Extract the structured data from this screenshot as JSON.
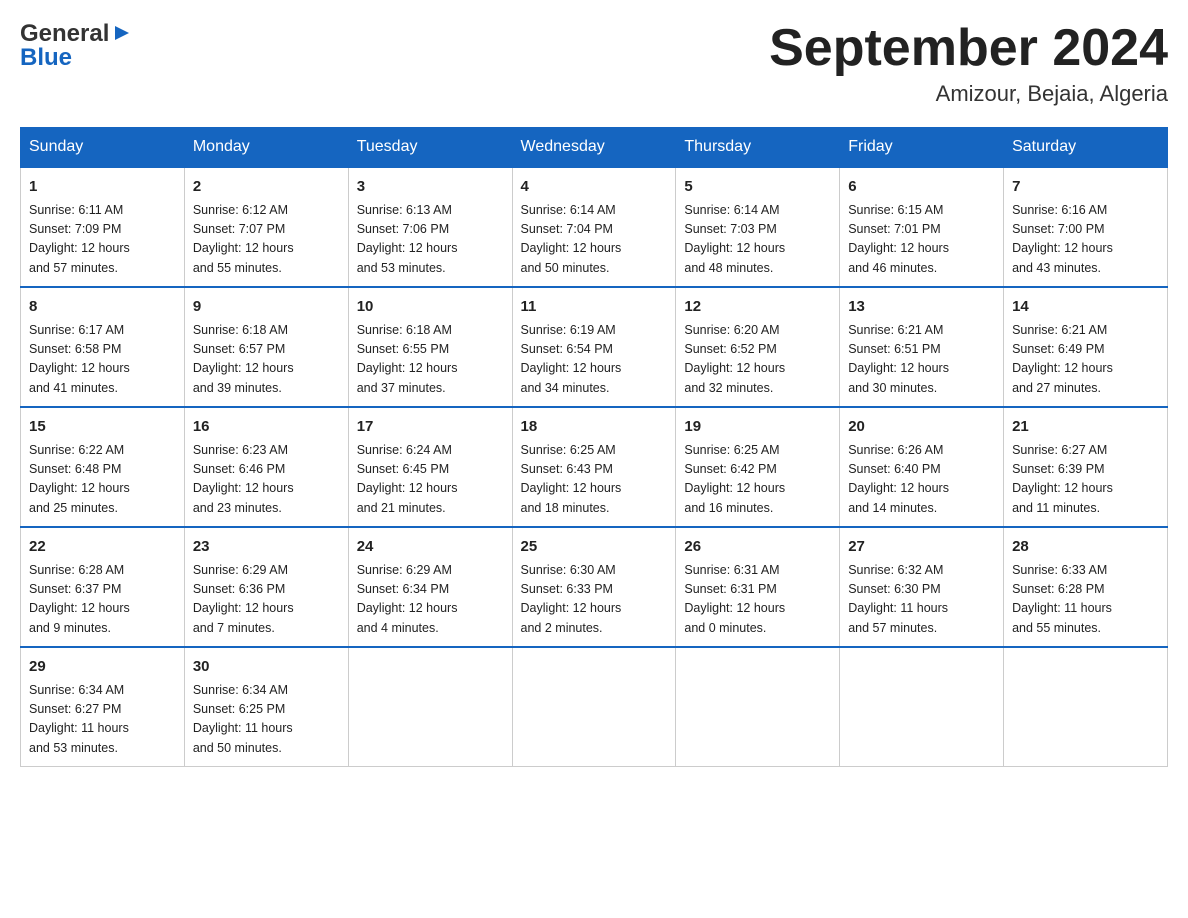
{
  "header": {
    "logo_general": "General",
    "logo_blue": "Blue",
    "month": "September 2024",
    "location": "Amizour, Bejaia, Algeria"
  },
  "days_of_week": [
    "Sunday",
    "Monday",
    "Tuesday",
    "Wednesday",
    "Thursday",
    "Friday",
    "Saturday"
  ],
  "weeks": [
    [
      {
        "day": "1",
        "sunrise": "6:11 AM",
        "sunset": "7:09 PM",
        "daylight": "12 hours and 57 minutes."
      },
      {
        "day": "2",
        "sunrise": "6:12 AM",
        "sunset": "7:07 PM",
        "daylight": "12 hours and 55 minutes."
      },
      {
        "day": "3",
        "sunrise": "6:13 AM",
        "sunset": "7:06 PM",
        "daylight": "12 hours and 53 minutes."
      },
      {
        "day": "4",
        "sunrise": "6:14 AM",
        "sunset": "7:04 PM",
        "daylight": "12 hours and 50 minutes."
      },
      {
        "day": "5",
        "sunrise": "6:14 AM",
        "sunset": "7:03 PM",
        "daylight": "12 hours and 48 minutes."
      },
      {
        "day": "6",
        "sunrise": "6:15 AM",
        "sunset": "7:01 PM",
        "daylight": "12 hours and 46 minutes."
      },
      {
        "day": "7",
        "sunrise": "6:16 AM",
        "sunset": "7:00 PM",
        "daylight": "12 hours and 43 minutes."
      }
    ],
    [
      {
        "day": "8",
        "sunrise": "6:17 AM",
        "sunset": "6:58 PM",
        "daylight": "12 hours and 41 minutes."
      },
      {
        "day": "9",
        "sunrise": "6:18 AM",
        "sunset": "6:57 PM",
        "daylight": "12 hours and 39 minutes."
      },
      {
        "day": "10",
        "sunrise": "6:18 AM",
        "sunset": "6:55 PM",
        "daylight": "12 hours and 37 minutes."
      },
      {
        "day": "11",
        "sunrise": "6:19 AM",
        "sunset": "6:54 PM",
        "daylight": "12 hours and 34 minutes."
      },
      {
        "day": "12",
        "sunrise": "6:20 AM",
        "sunset": "6:52 PM",
        "daylight": "12 hours and 32 minutes."
      },
      {
        "day": "13",
        "sunrise": "6:21 AM",
        "sunset": "6:51 PM",
        "daylight": "12 hours and 30 minutes."
      },
      {
        "day": "14",
        "sunrise": "6:21 AM",
        "sunset": "6:49 PM",
        "daylight": "12 hours and 27 minutes."
      }
    ],
    [
      {
        "day": "15",
        "sunrise": "6:22 AM",
        "sunset": "6:48 PM",
        "daylight": "12 hours and 25 minutes."
      },
      {
        "day": "16",
        "sunrise": "6:23 AM",
        "sunset": "6:46 PM",
        "daylight": "12 hours and 23 minutes."
      },
      {
        "day": "17",
        "sunrise": "6:24 AM",
        "sunset": "6:45 PM",
        "daylight": "12 hours and 21 minutes."
      },
      {
        "day": "18",
        "sunrise": "6:25 AM",
        "sunset": "6:43 PM",
        "daylight": "12 hours and 18 minutes."
      },
      {
        "day": "19",
        "sunrise": "6:25 AM",
        "sunset": "6:42 PM",
        "daylight": "12 hours and 16 minutes."
      },
      {
        "day": "20",
        "sunrise": "6:26 AM",
        "sunset": "6:40 PM",
        "daylight": "12 hours and 14 minutes."
      },
      {
        "day": "21",
        "sunrise": "6:27 AM",
        "sunset": "6:39 PM",
        "daylight": "12 hours and 11 minutes."
      }
    ],
    [
      {
        "day": "22",
        "sunrise": "6:28 AM",
        "sunset": "6:37 PM",
        "daylight": "12 hours and 9 minutes."
      },
      {
        "day": "23",
        "sunrise": "6:29 AM",
        "sunset": "6:36 PM",
        "daylight": "12 hours and 7 minutes."
      },
      {
        "day": "24",
        "sunrise": "6:29 AM",
        "sunset": "6:34 PM",
        "daylight": "12 hours and 4 minutes."
      },
      {
        "day": "25",
        "sunrise": "6:30 AM",
        "sunset": "6:33 PM",
        "daylight": "12 hours and 2 minutes."
      },
      {
        "day": "26",
        "sunrise": "6:31 AM",
        "sunset": "6:31 PM",
        "daylight": "12 hours and 0 minutes."
      },
      {
        "day": "27",
        "sunrise": "6:32 AM",
        "sunset": "6:30 PM",
        "daylight": "11 hours and 57 minutes."
      },
      {
        "day": "28",
        "sunrise": "6:33 AM",
        "sunset": "6:28 PM",
        "daylight": "11 hours and 55 minutes."
      }
    ],
    [
      {
        "day": "29",
        "sunrise": "6:34 AM",
        "sunset": "6:27 PM",
        "daylight": "11 hours and 53 minutes."
      },
      {
        "day": "30",
        "sunrise": "6:34 AM",
        "sunset": "6:25 PM",
        "daylight": "11 hours and 50 minutes."
      },
      null,
      null,
      null,
      null,
      null
    ]
  ],
  "labels": {
    "sunrise": "Sunrise:",
    "sunset": "Sunset:",
    "daylight": "Daylight:"
  }
}
